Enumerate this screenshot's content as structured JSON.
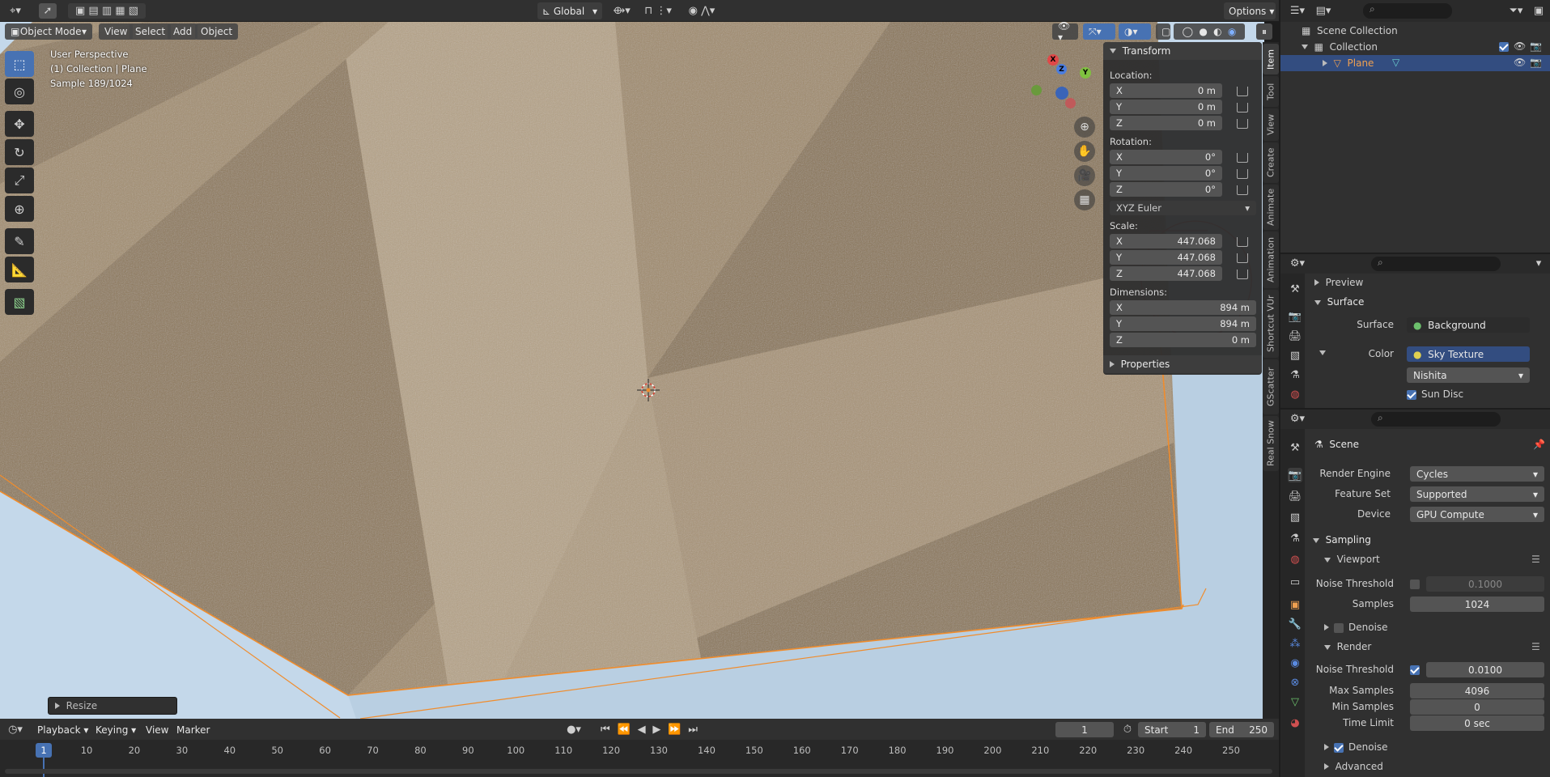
{
  "topbar": {
    "transform_orientation": "Global",
    "options_label": "Options"
  },
  "viewport_header": {
    "mode": "Object Mode",
    "menus": [
      "View",
      "Select",
      "Add",
      "Object"
    ]
  },
  "viewport_info": {
    "perspective": "User Perspective",
    "collection": "(1) Collection | Plane",
    "sample": "Sample 189/1024"
  },
  "gizmo": {
    "x": "X",
    "y": "Y",
    "z": "Z"
  },
  "operator_panel": {
    "label": "Resize"
  },
  "npanel": {
    "transform_title": "Transform",
    "location_label": "Location:",
    "location": [
      {
        "axis": "X",
        "value": "0 m"
      },
      {
        "axis": "Y",
        "value": "0 m"
      },
      {
        "axis": "Z",
        "value": "0 m"
      }
    ],
    "rotation_label": "Rotation:",
    "rotation": [
      {
        "axis": "X",
        "value": "0°"
      },
      {
        "axis": "Y",
        "value": "0°"
      },
      {
        "axis": "Z",
        "value": "0°"
      }
    ],
    "rotation_mode": "XYZ Euler",
    "scale_label": "Scale:",
    "scale": [
      {
        "axis": "X",
        "value": "447.068"
      },
      {
        "axis": "Y",
        "value": "447.068"
      },
      {
        "axis": "Z",
        "value": "447.068"
      }
    ],
    "dimensions_label": "Dimensions:",
    "dimensions": [
      {
        "axis": "X",
        "value": "894 m"
      },
      {
        "axis": "Y",
        "value": "894 m"
      },
      {
        "axis": "Z",
        "value": "0 m"
      }
    ],
    "properties_title": "Properties"
  },
  "side_tabs": [
    "Item",
    "Tool",
    "View",
    "Create",
    "Animate",
    "Animation",
    "Shortcut VUr",
    "GScatter",
    "Real Snow"
  ],
  "timeline": {
    "menus": [
      "Playback",
      "Keying",
      "View",
      "Marker"
    ],
    "current_frame": "1",
    "start_label": "Start",
    "start_value": "1",
    "end_label": "End",
    "end_value": "250",
    "ruler": [
      "1",
      "10",
      "20",
      "30",
      "40",
      "50",
      "60",
      "70",
      "80",
      "90",
      "100",
      "110",
      "120",
      "130",
      "140",
      "150",
      "160",
      "170",
      "180",
      "190",
      "200",
      "210",
      "220",
      "230",
      "240",
      "250"
    ]
  },
  "outliner": {
    "root": "Scene Collection",
    "collection": "Collection",
    "object": "Plane"
  },
  "world_panel": {
    "preview": "Preview",
    "surface_section": "Surface",
    "surface_label": "Surface",
    "surface_value": "Background",
    "color_label": "Color",
    "color_value": "Sky Texture",
    "sky_type": "Nishita",
    "sun_disc": "Sun Disc"
  },
  "render_panel": {
    "scene": "Scene",
    "render_engine_label": "Render Engine",
    "render_engine": "Cycles",
    "feature_set_label": "Feature Set",
    "feature_set": "Supported",
    "device_label": "Device",
    "device": "GPU Compute",
    "sampling": "Sampling",
    "viewport": "Viewport",
    "noise_threshold_label": "Noise Threshold",
    "viewport_noise_threshold": "0.1000",
    "samples_label": "Samples",
    "viewport_samples": "1024",
    "denoise": "Denoise",
    "render": "Render",
    "render_noise_threshold": "0.0100",
    "max_samples_label": "Max Samples",
    "max_samples": "4096",
    "min_samples_label": "Min Samples",
    "min_samples": "0",
    "time_limit_label": "Time Limit",
    "time_limit": "0 sec",
    "render_denoise": "Denoise",
    "advanced": "Advanced"
  }
}
